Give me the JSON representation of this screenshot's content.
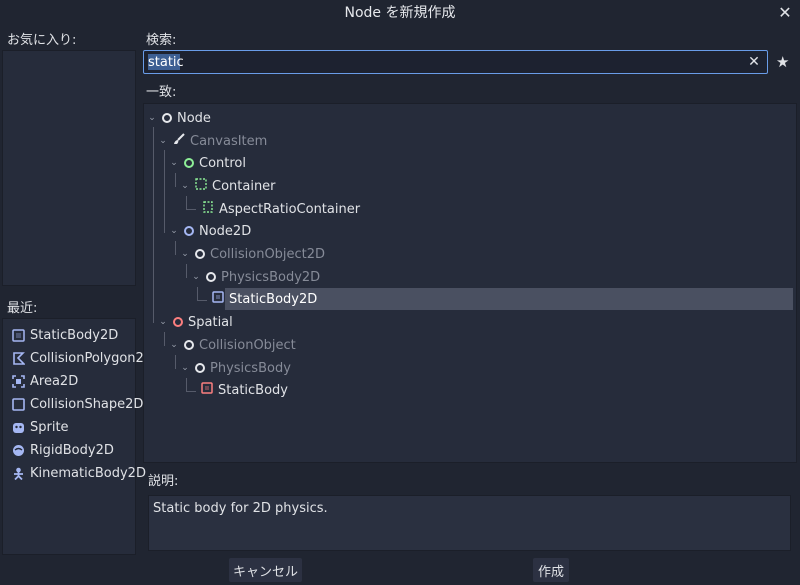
{
  "window": {
    "title": "Node を新規作成"
  },
  "favorites": {
    "label": "お気に入り:"
  },
  "recent": {
    "label": "最近:",
    "items": [
      {
        "label": "StaticBody2D",
        "icon": "static-body-icon",
        "color": "#a5b7f3"
      },
      {
        "label": "CollisionPolygon2",
        "icon": "collision-polygon-icon",
        "color": "#a5b7f3"
      },
      {
        "label": "Area2D",
        "icon": "area-icon",
        "color": "#a5b7f3"
      },
      {
        "label": "CollisionShape2D",
        "icon": "collision-shape-icon",
        "color": "#a5b7f3"
      },
      {
        "label": "Sprite",
        "icon": "sprite-icon",
        "color": "#a5b7f3"
      },
      {
        "label": "RigidBody2D",
        "icon": "rigid-body-icon",
        "color": "#a5b7f3"
      },
      {
        "label": "KinematicBody2D",
        "icon": "kinematic-body-icon",
        "color": "#a5b7f3"
      }
    ]
  },
  "search": {
    "label": "検索:",
    "value": "static"
  },
  "matches": {
    "label": "一致:",
    "tree": [
      {
        "label": "Node",
        "dim": false
      },
      {
        "label": "CanvasItem",
        "dim": true
      },
      {
        "label": "Control",
        "dim": false
      },
      {
        "label": "Container",
        "dim": false
      },
      {
        "label": "AspectRatioContainer",
        "dim": false
      },
      {
        "label": "Node2D",
        "dim": false
      },
      {
        "label": "CollisionObject2D",
        "dim": true
      },
      {
        "label": "PhysicsBody2D",
        "dim": true
      },
      {
        "label": "StaticBody2D",
        "dim": false,
        "selected": true
      },
      {
        "label": "Spatial",
        "dim": false
      },
      {
        "label": "CollisionObject",
        "dim": true
      },
      {
        "label": "PhysicsBody",
        "dim": true
      },
      {
        "label": "StaticBody",
        "dim": false
      }
    ]
  },
  "description": {
    "label": "説明:",
    "text": "Static body for 2D physics."
  },
  "buttons": {
    "cancel": "キャンセル",
    "create": "作成"
  },
  "colors": {
    "control": "#8eef97",
    "node2d": "#a5b7f3",
    "spatial": "#fc7f7f",
    "selection": "#4a5061",
    "accent": "#699ce8"
  }
}
